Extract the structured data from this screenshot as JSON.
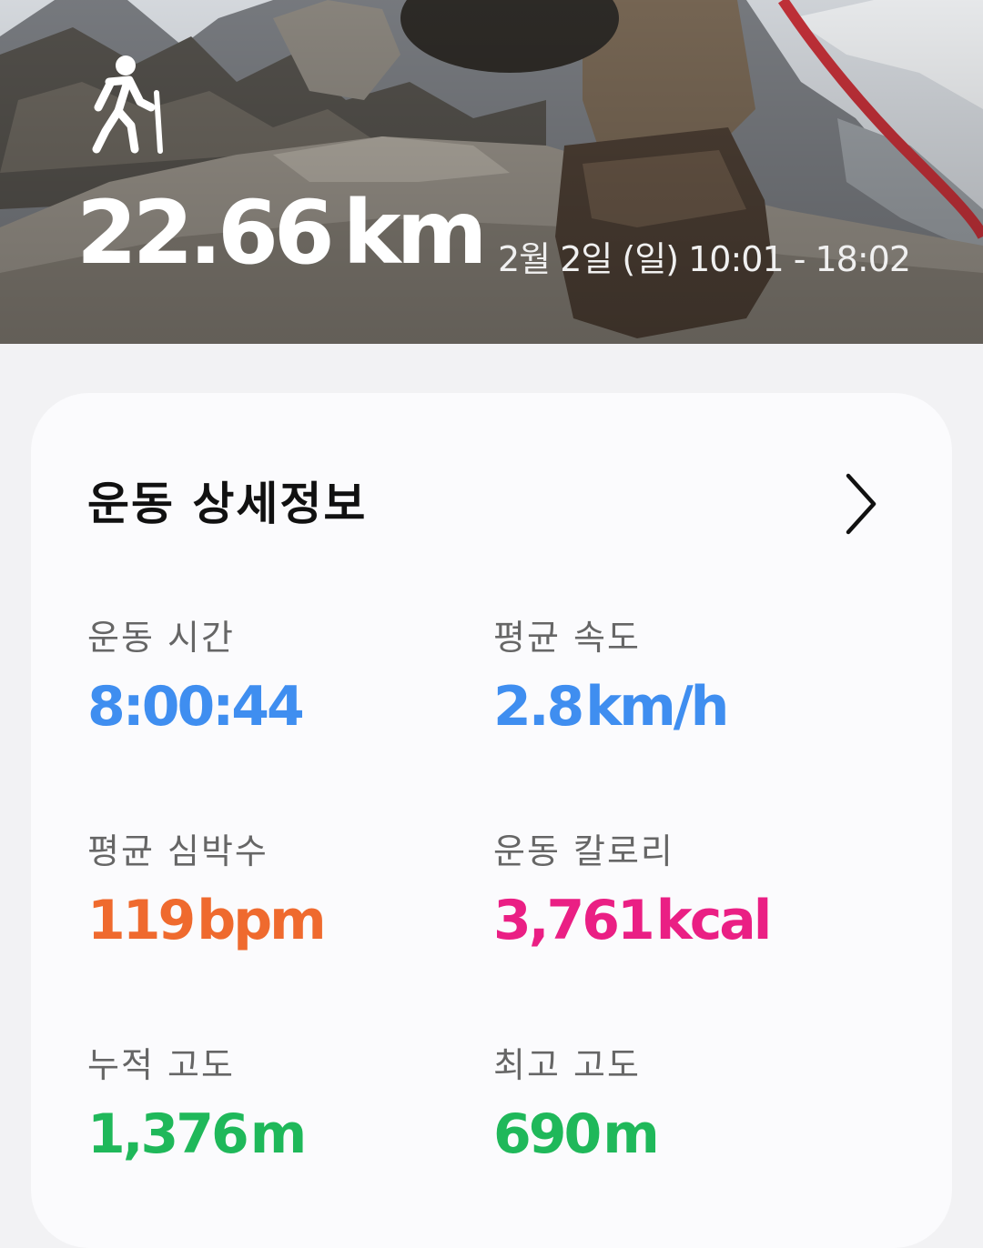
{
  "header": {
    "activity_icon": "hiking-icon",
    "distance_value": "22.66",
    "distance_unit": "km",
    "datetime": "2월 2일 (일) 10:01 - 18:02"
  },
  "details": {
    "title": "운동 상세정보",
    "more_icon": "chevron-right-icon",
    "stats": [
      {
        "label": "운동 시간",
        "value": "8:00:44",
        "unit": "",
        "color": "#3f8ef0"
      },
      {
        "label": "평균 속도",
        "value": "2.8",
        "unit": "km/h",
        "color": "#3f8ef0"
      },
      {
        "label": "평균 심박수",
        "value": "119",
        "unit": "bpm",
        "color": "#ef6a2e"
      },
      {
        "label": "운동 칼로리",
        "value": "3,761",
        "unit": "kcal",
        "color": "#ea1f84"
      },
      {
        "label": "누적 고도",
        "value": "1,376",
        "unit": "m",
        "color": "#1fb85a"
      },
      {
        "label": "최고 고도",
        "value": "690",
        "unit": "m",
        "color": "#1fb85a"
      }
    ]
  }
}
